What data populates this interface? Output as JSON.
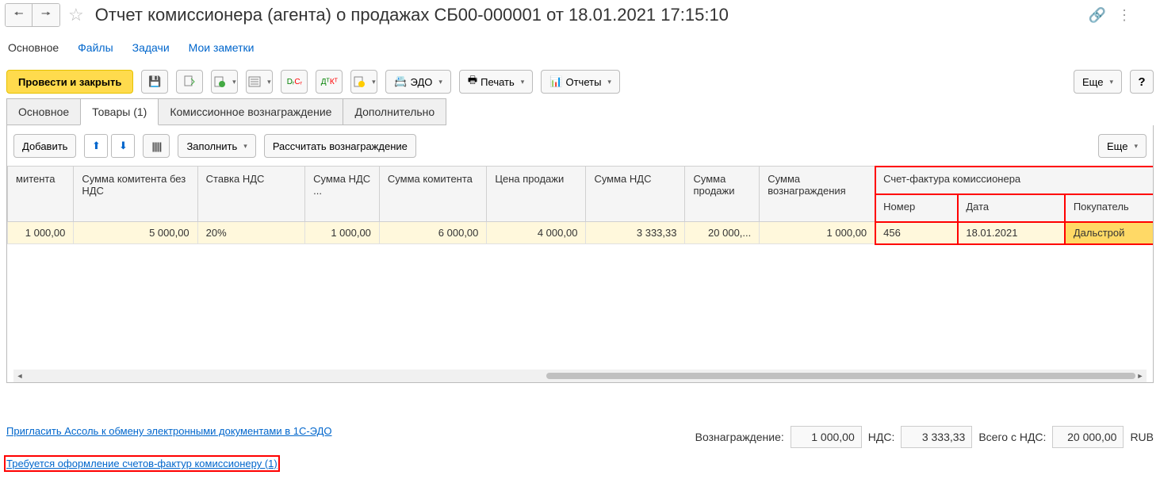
{
  "header": {
    "title": "Отчет комиссионера (агента) о продажах СБ00-000001 от 18.01.2021 17:15:10"
  },
  "nav": {
    "main": "Основное",
    "files": "Файлы",
    "tasks": "Задачи",
    "notes": "Мои заметки"
  },
  "toolbar": {
    "post_close": "Провести и закрыть",
    "edo": "ЭДО",
    "print": "Печать",
    "reports": "Отчеты",
    "more": "Еще",
    "help": "?"
  },
  "tabs": {
    "main": "Основное",
    "goods": "Товары (1)",
    "commission": "Комиссионное вознаграждение",
    "extra": "Дополнительно"
  },
  "row_toolbar": {
    "add": "Добавить",
    "fill": "Заполнить",
    "calc": "Рассчитать вознаграждение",
    "more": "Еще"
  },
  "table": {
    "headers": {
      "c0": "митента",
      "c1": "Сумма комитента без НДС",
      "c2": "Ставка НДС",
      "c3": "Сумма НДС ...",
      "c4": "Сумма комитента",
      "c5": "Цена продажи",
      "c6": "Сумма НДС",
      "c7": "Сумма продажи",
      "c8": "Сумма вознаграждения",
      "invoice_group": "Счет-фактура комиссионера",
      "inv_num": "Номер",
      "inv_date": "Дата",
      "inv_buyer": "Покупатель"
    },
    "row": {
      "c0": "1 000,00",
      "c1": "5 000,00",
      "c2": "20%",
      "c3": "1 000,00",
      "c4": "6 000,00",
      "c5": "4 000,00",
      "c6": "3 333,33",
      "c7": "20 000,...",
      "c8": "1 000,00",
      "inv_num": "456",
      "inv_date": "18.01.2021",
      "inv_buyer": "Дальстрой"
    }
  },
  "footer": {
    "link1": "Пригласить Ассоль к обмену электронными документами в 1С-ЭДО",
    "link2": "Требуется оформление счетов-фактур комиссионеру (1)",
    "reward_lbl": "Вознаграждение:",
    "reward_val": "1 000,00",
    "vat_lbl": "НДС:",
    "vat_val": "3 333,33",
    "total_lbl": "Всего с НДС:",
    "total_val": "20 000,00",
    "currency": "RUB"
  }
}
